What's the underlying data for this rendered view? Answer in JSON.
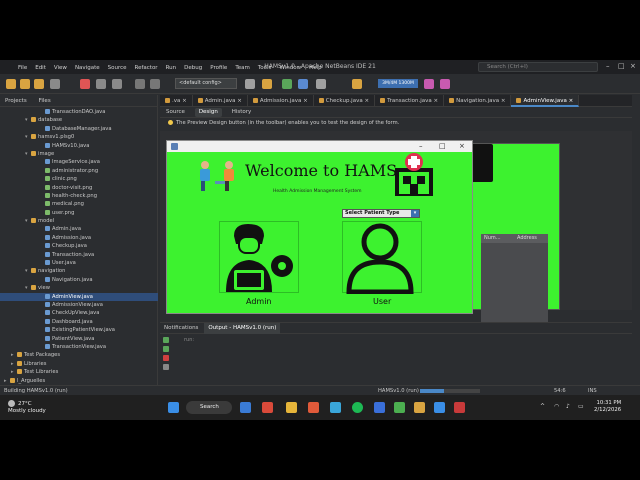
{
  "ide": {
    "window_title": "HAMSv1.0 - Apache NetBeans IDE 21",
    "search_placeholder": "Search (Ctrl+I)",
    "menu": [
      "File",
      "Edit",
      "View",
      "Navigate",
      "Source",
      "Refactor",
      "Run",
      "Debug",
      "Profile",
      "Team",
      "Tools",
      "Window",
      "Help"
    ],
    "config_value": "<default config>",
    "memory_label": "3M/4M 1300M"
  },
  "left_panel": {
    "tabs": [
      "Projects",
      "Files"
    ],
    "tree": [
      {
        "label": "TransactionDAO.java",
        "icon": "file",
        "indent": 5,
        "selected": false,
        "arrow": ""
      },
      {
        "label": "database",
        "icon": "folder",
        "indent": 3,
        "selected": false,
        "arrow": "▾"
      },
      {
        "label": "DatabaseManager.java",
        "icon": "file",
        "indent": 5,
        "selected": false,
        "arrow": ""
      },
      {
        "label": "hamsv1.plsg0",
        "icon": "folder",
        "indent": 3,
        "selected": false,
        "arrow": "▾"
      },
      {
        "label": "HAMSv10.java",
        "icon": "file",
        "indent": 5,
        "selected": false,
        "arrow": ""
      },
      {
        "label": "image",
        "icon": "folder",
        "indent": 3,
        "selected": false,
        "arrow": "▾"
      },
      {
        "label": "ImageService.java",
        "icon": "file",
        "indent": 5,
        "selected": false,
        "arrow": ""
      },
      {
        "label": "administrator.png",
        "icon": "img",
        "indent": 5,
        "selected": false,
        "arrow": ""
      },
      {
        "label": "clinic.png",
        "icon": "img",
        "indent": 5,
        "selected": false,
        "arrow": ""
      },
      {
        "label": "doctor-visit.png",
        "icon": "img",
        "indent": 5,
        "selected": false,
        "arrow": ""
      },
      {
        "label": "health-check.png",
        "icon": "img",
        "indent": 5,
        "selected": false,
        "arrow": ""
      },
      {
        "label": "medical.png",
        "icon": "img",
        "indent": 5,
        "selected": false,
        "arrow": ""
      },
      {
        "label": "user.png",
        "icon": "img",
        "indent": 5,
        "selected": false,
        "arrow": ""
      },
      {
        "label": "model",
        "icon": "folder",
        "indent": 3,
        "selected": false,
        "arrow": "▾"
      },
      {
        "label": "Admin.java",
        "icon": "file",
        "indent": 5,
        "selected": false,
        "arrow": ""
      },
      {
        "label": "Admission.java",
        "icon": "file",
        "indent": 5,
        "selected": false,
        "arrow": ""
      },
      {
        "label": "Checkup.java",
        "icon": "file",
        "indent": 5,
        "selected": false,
        "arrow": ""
      },
      {
        "label": "Transaction.java",
        "icon": "file",
        "indent": 5,
        "selected": false,
        "arrow": ""
      },
      {
        "label": "User.java",
        "icon": "file",
        "indent": 5,
        "selected": false,
        "arrow": ""
      },
      {
        "label": "navigation",
        "icon": "folder",
        "indent": 3,
        "selected": false,
        "arrow": "▾"
      },
      {
        "label": "Navigation.java",
        "icon": "file",
        "indent": 5,
        "selected": false,
        "arrow": ""
      },
      {
        "label": "view",
        "icon": "folder",
        "indent": 3,
        "selected": false,
        "arrow": "▾"
      },
      {
        "label": "AdminView.java",
        "icon": "file",
        "indent": 5,
        "selected": true,
        "arrow": ""
      },
      {
        "label": "AdmissionView.java",
        "icon": "file",
        "indent": 5,
        "selected": false,
        "arrow": ""
      },
      {
        "label": "CheckUpView.java",
        "icon": "file",
        "indent": 5,
        "selected": false,
        "arrow": ""
      },
      {
        "label": "Dashboard.java",
        "icon": "file",
        "indent": 5,
        "selected": false,
        "arrow": ""
      },
      {
        "label": "ExistingPatientView.java",
        "icon": "file",
        "indent": 5,
        "selected": false,
        "arrow": ""
      },
      {
        "label": "PatientView.java",
        "icon": "file",
        "indent": 5,
        "selected": false,
        "arrow": ""
      },
      {
        "label": "TransactionView.java",
        "icon": "file",
        "indent": 5,
        "selected": false,
        "arrow": ""
      },
      {
        "label": "Test Packages",
        "icon": "folder",
        "indent": 1,
        "selected": false,
        "arrow": "▸"
      },
      {
        "label": "Libraries",
        "icon": "folder",
        "indent": 1,
        "selected": false,
        "arrow": "▸"
      },
      {
        "label": "Test Libraries",
        "icon": "folder",
        "indent": 1,
        "selected": false,
        "arrow": "▸"
      },
      {
        "label": "l_Arguelles",
        "icon": "folder",
        "indent": 0,
        "selected": false,
        "arrow": "▸"
      }
    ]
  },
  "editor": {
    "tabs": [
      ".va",
      "Admin.java",
      "Admission.java",
      "Checkup.java",
      "Transaction.java",
      "Navigation.java",
      "AdminView.java"
    ],
    "active_tab": 6,
    "design_tabs": [
      "Source",
      "Design",
      "History"
    ],
    "hint": "The Preview Design button (in the toolbar) enables you to test the design of the form.",
    "table_headers": [
      "Num...",
      "Address"
    ]
  },
  "preview": {
    "welcome": "Welcome to HAMS",
    "subtitle": "Health Admission Management System",
    "select_label": "Select Patient Type",
    "admin_label": "Admin",
    "user_label": "User"
  },
  "output": {
    "tabs": [
      "Notifications",
      "Output - HAMSv1.0 (run)"
    ],
    "active_tab": 1,
    "text": "run:"
  },
  "status": {
    "building": "Building HAMSv1.0 (run)",
    "task": "HAMSv1.0 (run)",
    "position": "54:6",
    "mode": "INS",
    "progress": 0.4
  },
  "taskbar": {
    "temperature": "27°C",
    "weather": "Mostly cloudy",
    "search_label": "Search",
    "time": "10:31 PM",
    "date": "2/12/2026"
  }
}
